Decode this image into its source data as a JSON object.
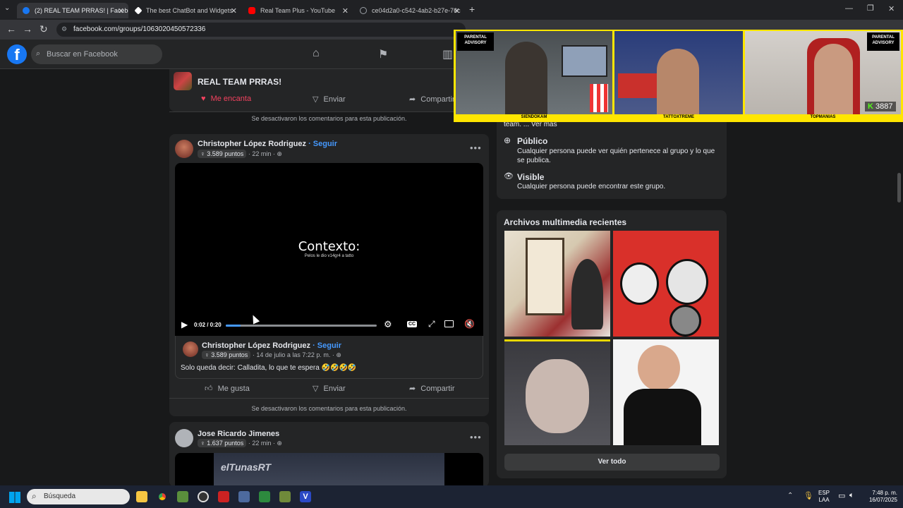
{
  "browser": {
    "tabs": [
      {
        "label": "(2) REAL TEAM PRRAS! | Facebo",
        "color": "#1877f2"
      },
      {
        "label": "The best ChatBot and Widgets",
        "color": "#ffffff"
      },
      {
        "label": "Real Team Plus - YouTube",
        "color": "#ff0000"
      },
      {
        "label": "ce04d2a0-c542-4ab2-b27e-76c",
        "color": "#9aa0a6"
      }
    ],
    "new_tab": "+",
    "url": "facebook.com/groups/1063020450572336"
  },
  "fb": {
    "search_placeholder": "Buscar en Facebook"
  },
  "group_post": {
    "name": "REAL TEAM PRRAS!",
    "reaction": "Me encanta",
    "send": "Enviar",
    "share": "Compartir",
    "comments_off": "Se desactivaron los comentarios para esta publicación."
  },
  "post1": {
    "author": "Christopher López Rodriguez",
    "follow": "· Seguir",
    "points": "3.589 puntos",
    "time": "· 22 min ·",
    "video_title": "Contexto:",
    "video_subtitle": "Pelos le dio v14gr4 a tatto",
    "video_time": "0:02 / 0:20",
    "progress": 0.1,
    "shared_author": "Christopher López Rodriguez",
    "shared_follow": "· Seguir",
    "shared_points": "3.589 puntos",
    "shared_time": "· 14 de julio a las 7:22 p. m. ·",
    "shared_text": "Solo queda decir: Calladita, lo que te espera 🤣🤣🤣🤣",
    "like": "Me gusta",
    "send": "Enviar",
    "share": "Compartir",
    "comments_off": "Se desactivaron los comentarios para esta publicación."
  },
  "post2": {
    "author": "Jose Ricardo Jimenes",
    "points": "1.637 puntos",
    "time": "· 22 min ·",
    "video_text": "elTunasRT"
  },
  "about": {
    "more": "team. ... Ver más",
    "public_title": "Público",
    "public_desc": "Cualquier persona puede ver quién pertenece al grupo y lo que se publica.",
    "visible_title": "Visible",
    "visible_desc": "Cualquier persona puede encontrar este grupo."
  },
  "media": {
    "title": "Archivos multimedia recientes",
    "see_all": "Ver todo"
  },
  "overlay": {
    "cams": [
      "SIENDOKAM",
      "TATTOXTREME",
      "TOPMANIAS"
    ],
    "viewers": "3887"
  },
  "taskbar": {
    "search": "Búsqueda",
    "lang1": "ESP",
    "lang2": "LAA",
    "time": "7:48 p. m.",
    "date": "16/07/2025"
  }
}
